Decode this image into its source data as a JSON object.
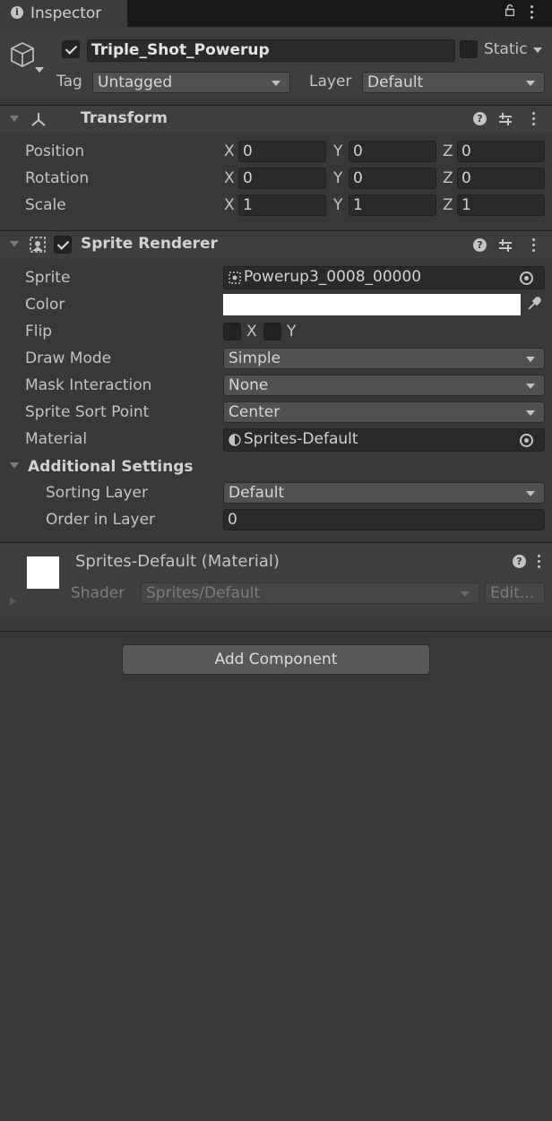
{
  "tab": {
    "title": "Inspector"
  },
  "gameobject": {
    "name": "Triple_Shot_Powerup",
    "static_label": "Static",
    "tag_label": "Tag",
    "tag_value": "Untagged",
    "layer_label": "Layer",
    "layer_value": "Default"
  },
  "transform": {
    "title": "Transform",
    "rows": [
      {
        "label": "Position",
        "x": "0",
        "y": "0",
        "z": "0"
      },
      {
        "label": "Rotation",
        "x": "0",
        "y": "0",
        "z": "0"
      },
      {
        "label": "Scale",
        "x": "1",
        "y": "1",
        "z": "1"
      }
    ],
    "axis_x": "X",
    "axis_y": "Y",
    "axis_z": "Z"
  },
  "sprite_renderer": {
    "title": "Sprite Renderer",
    "sprite_label": "Sprite",
    "sprite_value": "Powerup3_0008_00000",
    "color_label": "Color",
    "color_value": "#ffffff",
    "flip_label": "Flip",
    "flip_x": "X",
    "flip_y": "Y",
    "draw_mode_label": "Draw Mode",
    "draw_mode_value": "Simple",
    "mask_label": "Mask Interaction",
    "mask_value": "None",
    "sort_point_label": "Sprite Sort Point",
    "sort_point_value": "Center",
    "material_label": "Material",
    "material_value": "Sprites-Default",
    "additional_title": "Additional Settings",
    "sorting_layer_label": "Sorting Layer",
    "sorting_layer_value": "Default",
    "order_label": "Order in Layer",
    "order_value": "0"
  },
  "material": {
    "title": "Sprites-Default (Material)",
    "shader_label": "Shader",
    "shader_value": "Sprites/Default",
    "edit_label": "Edit..."
  },
  "add_component": {
    "label": "Add Component"
  },
  "colors": {
    "background": "#383838",
    "header": "#3e3e3e",
    "tabbar": "#191919"
  }
}
